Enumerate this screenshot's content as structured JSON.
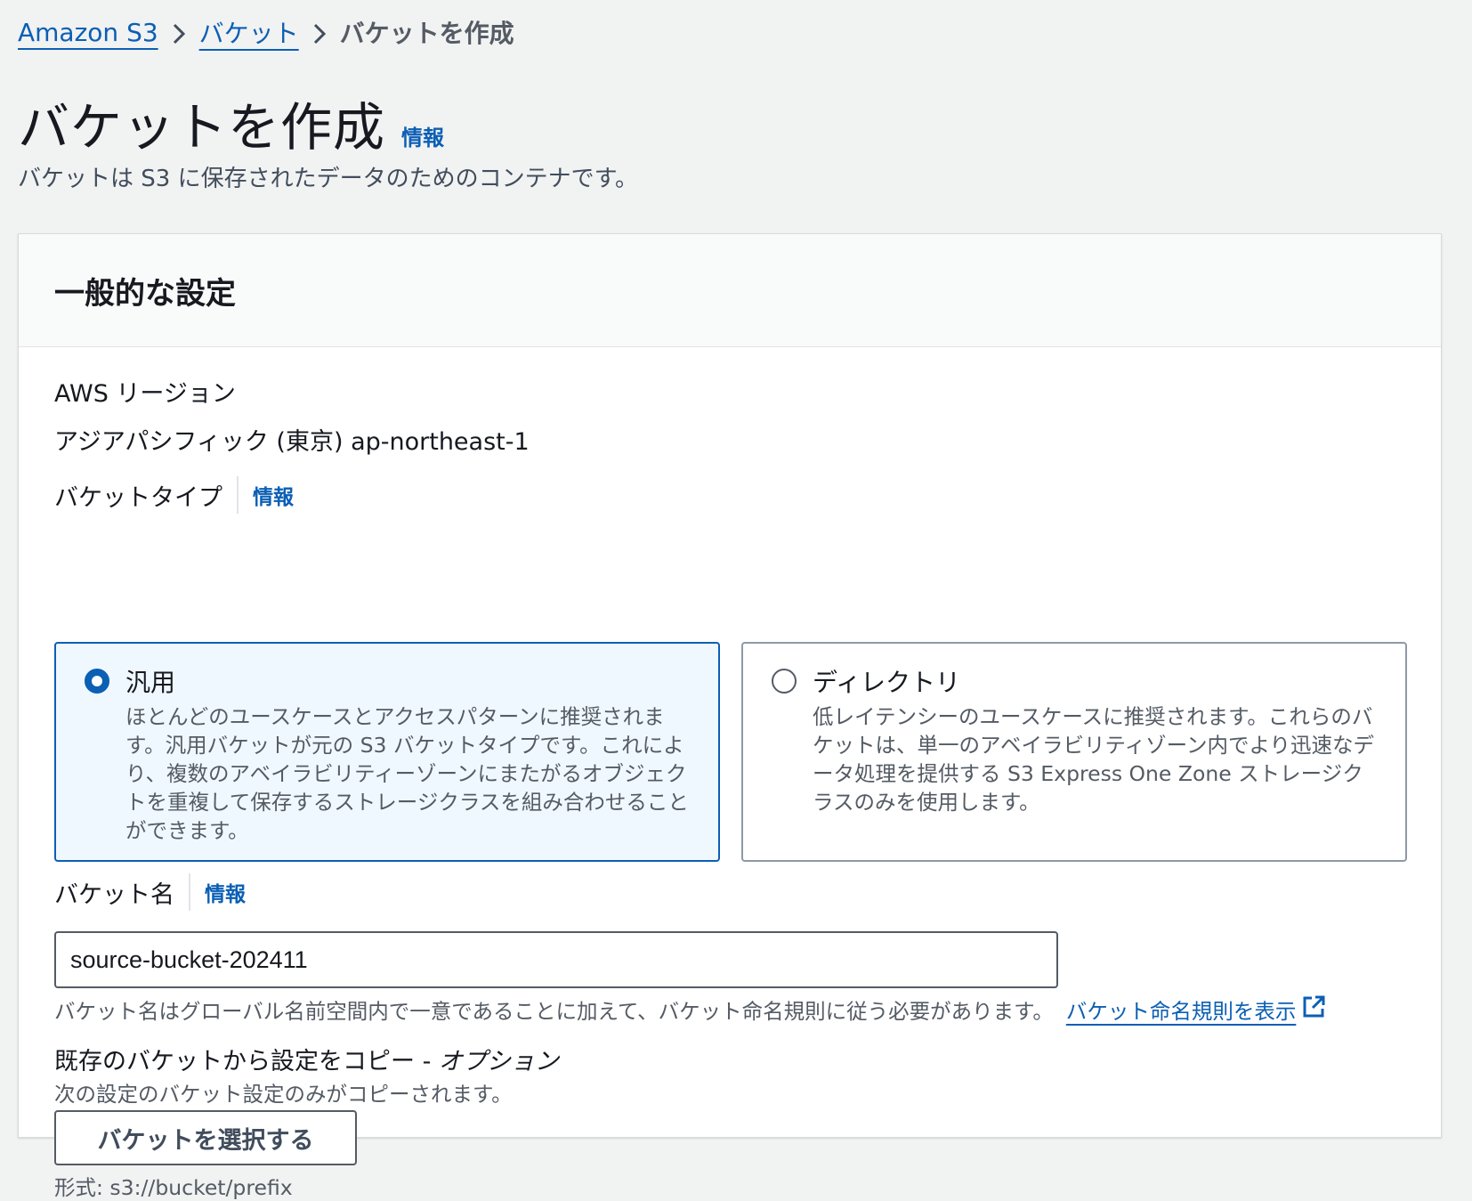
{
  "breadcrumb": {
    "items": [
      "Amazon S3",
      "バケット"
    ],
    "current": "バケットを作成"
  },
  "header": {
    "title": "バケットを作成",
    "info_label": "情報",
    "description": "バケットは S3 に保存されたデータのためのコンテナです。"
  },
  "panel": {
    "title": "一般的な設定",
    "region": {
      "label": "AWS リージョン",
      "value": "アジアパシフィック (東京) ap-northeast-1"
    },
    "bucket_type": {
      "label": "バケットタイプ",
      "info_label": "情報",
      "options": [
        {
          "title": "汎用",
          "selected": true,
          "description": "ほとんどのユースケースとアクセスパターンに推奨されます。汎用バケットが元の S3 バケットタイプです。これにより、複数のアベイラビリティーゾーンにまたがるオブジェクトを重複して保存するストレージクラスを組み合わせることができます。"
        },
        {
          "title": "ディレクトリ",
          "selected": false,
          "description": "低レイテンシーのユースケースに推奨されます。これらのバケットは、単一のアベイラビリティゾーン内でより迅速なデータ処理を提供する S3 Express One Zone ストレージクラスのみを使用します。"
        }
      ]
    },
    "bucket_name": {
      "label": "バケット名",
      "info_label": "情報",
      "value": "source-bucket-202411",
      "hint": "バケット名はグローバル名前空間内で一意であることに加えて、バケット命名規則に従う必要があります。",
      "hint_link": "バケット命名規則を表示"
    },
    "copy_settings": {
      "label": "既存のバケットから設定をコピー - ",
      "label_optional": "オプション",
      "description": "次の設定のバケット設定のみがコピーされます。",
      "button_label": "バケットを選択する",
      "format": "形式: s3://bucket/prefix"
    }
  },
  "colors": {
    "link": "#0b5fb4",
    "selected_tile_bg": "#f0f8ff",
    "page_bg": "#f1f2f2"
  }
}
